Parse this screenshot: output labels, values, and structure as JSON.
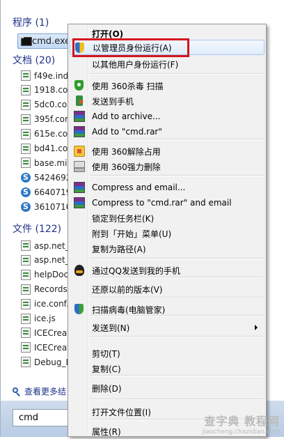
{
  "start_menu": {
    "programs_header": "程序 (1)",
    "programs": [
      {
        "label": "cmd.exe",
        "icon": "cmd-icon"
      }
    ],
    "documents_header": "文档 (20)",
    "documents": [
      {
        "label": "f49e.ind",
        "icon": "file-icon"
      },
      {
        "label": "1918.co",
        "icon": "file-icon"
      },
      {
        "label": "5dc0.co",
        "icon": "file-icon"
      },
      {
        "label": "395f.cor",
        "icon": "file-icon"
      },
      {
        "label": "615e.co",
        "icon": "file-icon"
      },
      {
        "label": "bd41.co",
        "icon": "file-icon"
      },
      {
        "label": "base.mi",
        "icon": "file-icon"
      },
      {
        "label": "5424692",
        "icon": "sogou-icon"
      },
      {
        "label": "6640719",
        "icon": "sogou-icon"
      },
      {
        "label": "3610710",
        "icon": "sogou-icon"
      }
    ],
    "files_header": "文件 (122)",
    "files": [
      {
        "label": "asp.net_",
        "icon": "file-icon"
      },
      {
        "label": "asp.net_",
        "icon": "file-icon"
      },
      {
        "label": "helpDoc",
        "icon": "file-icon"
      },
      {
        "label": "Records",
        "icon": "file-icon"
      },
      {
        "label": "ice.conf.",
        "icon": "file-icon"
      },
      {
        "label": "ice.js",
        "icon": "file-icon"
      },
      {
        "label": "ICECreat",
        "icon": "file-icon"
      },
      {
        "label": "ICECreat",
        "icon": "file-icon"
      },
      {
        "label": "Debug_L",
        "icon": "file-icon"
      }
    ],
    "more_results": "查看更多结",
    "search_value": "cmd"
  },
  "context_menu": {
    "items": [
      {
        "label": "打开(O)",
        "icon": "",
        "bold": true
      },
      {
        "label": "以管理员身份运行(A)",
        "icon": "uac-shield-icon",
        "highlighted": true
      },
      {
        "label": "以其他用户身份运行(F)",
        "icon": ""
      },
      {
        "label": "使用 360杀毒 扫描",
        "icon": "360-antivirus-icon"
      },
      {
        "label": "发送到手机",
        "icon": "send-to-phone-icon"
      },
      {
        "label": "Add to archive...",
        "icon": "winrar-icon"
      },
      {
        "label": "Add to \"cmd.rar\"",
        "icon": "winrar-icon"
      },
      {
        "label": "使用 360解除占用",
        "icon": "360-unlock-icon"
      },
      {
        "label": "使用 360强力删除",
        "icon": "360-shred-icon"
      },
      {
        "label": "Compress and email...",
        "icon": "winrar-icon"
      },
      {
        "label": "Compress to \"cmd.rar\" and email",
        "icon": "winrar-icon"
      },
      {
        "label": "锁定到任务栏(K)",
        "icon": ""
      },
      {
        "label": "附到「开始」菜单(U)",
        "icon": ""
      },
      {
        "label": "复制为路径(A)",
        "icon": ""
      },
      {
        "label": "通过QQ发送到我的手机",
        "icon": "qq-icon"
      },
      {
        "label": "还原以前的版本(V)",
        "icon": ""
      },
      {
        "label": "扫描病毒(电脑管家)",
        "icon": "pc-manager-icon"
      },
      {
        "label": "发送到(N)",
        "icon": "",
        "submenu": true
      },
      {
        "label": "剪切(T)",
        "icon": ""
      },
      {
        "label": "复制(C)",
        "icon": ""
      },
      {
        "label": "删除(D)",
        "icon": ""
      },
      {
        "label": "打开文件位置(I)",
        "icon": ""
      },
      {
        "label": "属性(R)",
        "icon": ""
      }
    ]
  },
  "watermark": {
    "main": "查字典 教程网",
    "url": "jiaocheng.chazidian.com"
  },
  "colors": {
    "highlight_box": "#d5141c",
    "section_header": "#1e3287"
  }
}
